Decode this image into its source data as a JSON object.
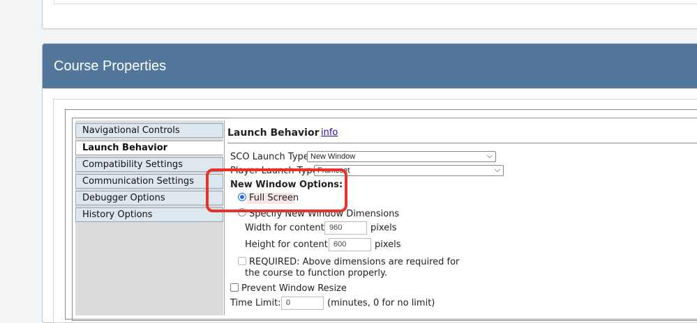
{
  "panel": {
    "title": "Course Properties"
  },
  "sidebar": {
    "items": [
      {
        "label": "Navigational Controls",
        "active": false
      },
      {
        "label": "Launch Behavior",
        "active": true
      },
      {
        "label": "Compatibility Settings",
        "active": false
      },
      {
        "label": "Communication Settings",
        "active": false
      },
      {
        "label": "Debugger Options",
        "active": false
      },
      {
        "label": "History Options",
        "active": false
      }
    ]
  },
  "content": {
    "section_title": "Launch Behavior",
    "info_link": "info",
    "sco_launch_type": {
      "label": "SCO Launch Type",
      "value": "New Window"
    },
    "player_launch_type": {
      "label": "Player Launch Type",
      "value": "Frameset"
    },
    "new_window_options": {
      "heading": "New Window Options:",
      "full_screen_label": "Full Screen",
      "full_screen_selected": true,
      "specify_label": "Specify New Window Dimensions",
      "specify_selected": false,
      "width_label": "Width for content:",
      "width_value": "960",
      "height_label": "Height for content:",
      "height_value": "600",
      "pixels_label": "pixels",
      "required_label_line1": "REQUIRED: Above dimensions are required for",
      "required_label_line2": "the course to function properly.",
      "required_checked": false
    },
    "prevent_resize": {
      "label": "Prevent Window Resize",
      "checked": false
    },
    "time_limit": {
      "label": "Time Limit:",
      "value": "0",
      "hint": "(minutes, 0 for no limit)"
    }
  },
  "colors": {
    "header": "#52779a",
    "highlight": "#e8312b",
    "radio_selected": "#1b6fe8"
  }
}
